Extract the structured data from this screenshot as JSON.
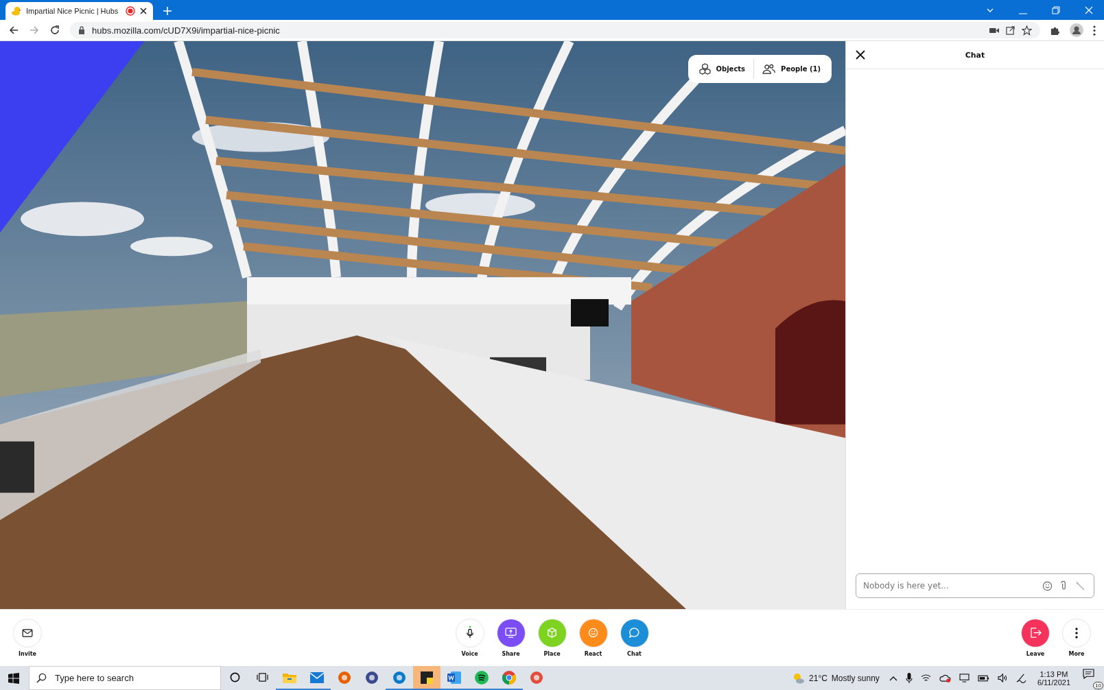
{
  "browser": {
    "tab": {
      "title": "Impartial Nice Picnic | Hubs",
      "recording": true
    },
    "url": "hubs.mozilla.com/cUD7X9i/impartial-nice-picnic"
  },
  "scene": {
    "overlay_buttons": [
      {
        "label": "Objects",
        "kind": "objects"
      },
      {
        "label": "People (1)",
        "kind": "people"
      }
    ]
  },
  "chat": {
    "title": "Chat",
    "input": {
      "placeholder": "Nobody is here yet..."
    }
  },
  "toolbar": {
    "left": [
      {
        "label": "Invite",
        "kind": "invite",
        "color": "#ffffff"
      }
    ],
    "center": [
      {
        "label": "Voice",
        "kind": "voice",
        "color": "#ffffff"
      },
      {
        "label": "Share",
        "kind": "share",
        "color": "#7b4ef5"
      },
      {
        "label": "Place",
        "kind": "place",
        "color": "#7ed321"
      },
      {
        "label": "React",
        "kind": "react",
        "color": "#ff8c1a"
      },
      {
        "label": "Chat",
        "kind": "chat",
        "color": "#1c8ed8"
      }
    ],
    "right": [
      {
        "label": "Leave",
        "kind": "leave",
        "color": "#f5325c"
      },
      {
        "label": "More",
        "kind": "more",
        "color": "#ffffff"
      }
    ]
  },
  "taskbar": {
    "search": {
      "placeholder": "Type here to search"
    },
    "apps": [
      {
        "kind": "cortana",
        "running": false,
        "selected": false
      },
      {
        "kind": "taskview",
        "running": false,
        "selected": false
      },
      {
        "kind": "explorer",
        "running": true,
        "selected": false
      },
      {
        "kind": "mail",
        "running": true,
        "selected": false
      },
      {
        "kind": "firefox",
        "running": false,
        "selected": false
      },
      {
        "kind": "disc",
        "running": false,
        "selected": false
      },
      {
        "kind": "edge",
        "running": true,
        "selected": false
      },
      {
        "kind": "notes",
        "running": true,
        "selected": true
      },
      {
        "kind": "word",
        "running": true,
        "selected": false
      },
      {
        "kind": "spotify",
        "running": true,
        "selected": false
      },
      {
        "kind": "chrome",
        "running": true,
        "selected": false
      },
      {
        "kind": "paint",
        "running": false,
        "selected": false
      }
    ],
    "weather": {
      "temperature": "21°C",
      "condition": "Mostly sunny"
    },
    "time": "1:13 PM",
    "date": "6/11/2021",
    "notifications": "10"
  }
}
